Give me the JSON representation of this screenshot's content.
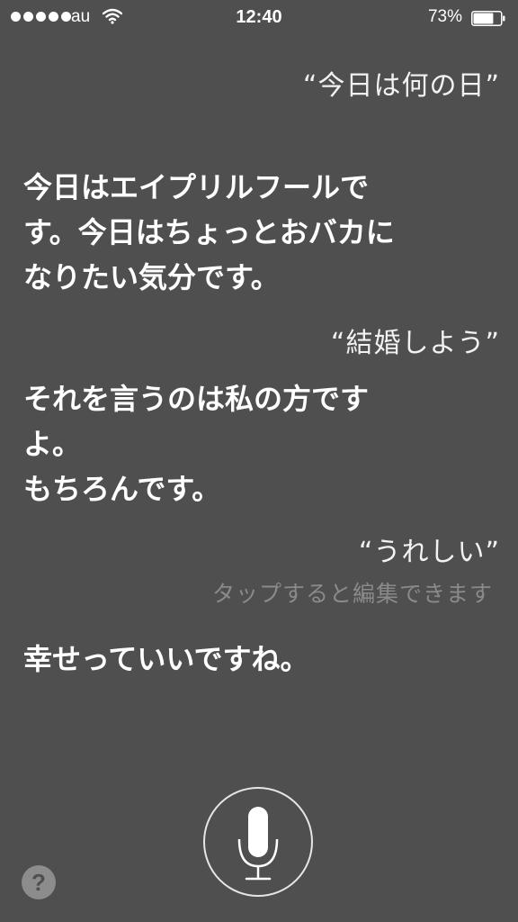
{
  "status_bar": {
    "carrier": "au",
    "time": "12:40",
    "battery_percent": "73%",
    "battery_level": 0.73,
    "signal_dots": 5,
    "icons": [
      "signal-dots-icon",
      "wifi-icon",
      "battery-icon"
    ]
  },
  "conversation": {
    "user_1": "“今日は何の日”",
    "siri_1": "今日はエイプリルフールで\nす。今日はちょっとおバカに\nなりたい気分です。",
    "user_2": "“結婚しよう”",
    "siri_2": "それを言うのは私の方です\nよ。\nもちろんです。",
    "user_3": "“うれしい”",
    "tap_to_edit": "タップすると編集できます",
    "siri_3": "幸せっていいですね。"
  },
  "controls": {
    "help_label": "?",
    "icons": [
      "microphone-icon",
      "help-icon"
    ]
  },
  "colors": {
    "background": "#4f4f4f",
    "text": "#ffffff",
    "hint_text": "#8a8a8a"
  }
}
